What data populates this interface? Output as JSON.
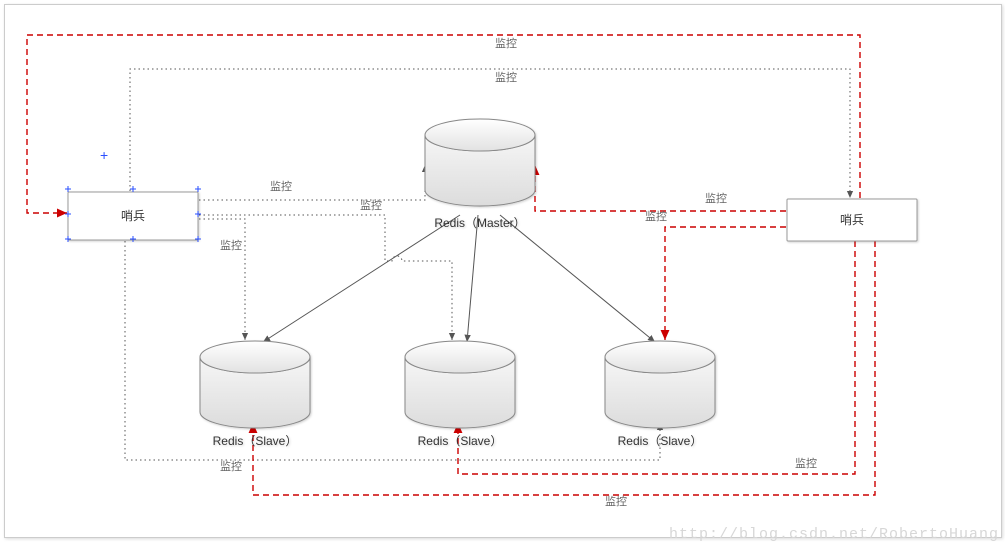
{
  "diagram": {
    "watermark": "http://blog.csdn.net/RobertoHuang",
    "nodes": {
      "sentinel_left": {
        "label": "哨兵"
      },
      "sentinel_right": {
        "label": "哨兵"
      },
      "master": {
        "label": "Redis（Master）"
      },
      "slave1": {
        "label": "Redis（Slave）"
      },
      "slave2": {
        "label": "Redis（Slave）"
      },
      "slave3": {
        "label": "Redis（Slave）"
      }
    },
    "edge_label": "监控",
    "edges": {
      "sl_master": "监控",
      "sl_slave1": "监控",
      "sl_slave2": "监控",
      "sl_slave3": "监控",
      "sr_master": "监控",
      "sr_slave1": "监控",
      "sr_slave2": "监控",
      "sr_slave3": "监控",
      "sl_sr_top": "监控",
      "sr_sl_top": "监控"
    }
  }
}
